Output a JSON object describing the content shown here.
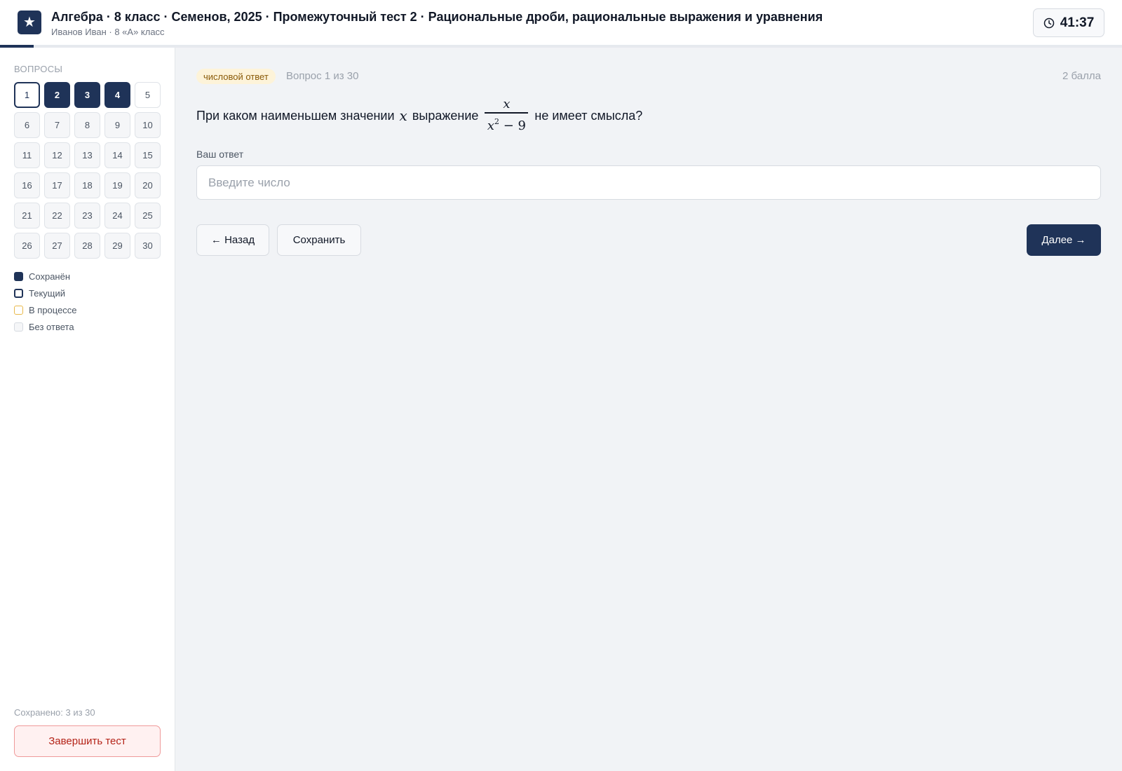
{
  "header": {
    "logo_icon": "star-icon",
    "title": "Алгебра · 8 класс · Семенов, 2025 · Промежуточный тест 2 · Рациональные дроби, рациональные выражения и уравнения",
    "subtitle": "Иванов Иван · 8 «А» класс",
    "timer": "41:37",
    "progress_fraction": 0.03
  },
  "sidebar": {
    "heading": "ВОПРОСЫ",
    "questions": [
      {
        "n": "1",
        "state": "current"
      },
      {
        "n": "2",
        "state": "saved"
      },
      {
        "n": "3",
        "state": "saved"
      },
      {
        "n": "4",
        "state": "saved"
      },
      {
        "n": "5",
        "state": "plain"
      },
      {
        "n": "6",
        "state": "empty"
      },
      {
        "n": "7",
        "state": "empty"
      },
      {
        "n": "8",
        "state": "empty"
      },
      {
        "n": "9",
        "state": "empty"
      },
      {
        "n": "10",
        "state": "empty"
      },
      {
        "n": "11",
        "state": "empty"
      },
      {
        "n": "12",
        "state": "empty"
      },
      {
        "n": "13",
        "state": "empty"
      },
      {
        "n": "14",
        "state": "empty"
      },
      {
        "n": "15",
        "state": "empty"
      },
      {
        "n": "16",
        "state": "empty"
      },
      {
        "n": "17",
        "state": "empty"
      },
      {
        "n": "18",
        "state": "empty"
      },
      {
        "n": "19",
        "state": "empty"
      },
      {
        "n": "20",
        "state": "empty"
      },
      {
        "n": "21",
        "state": "empty"
      },
      {
        "n": "22",
        "state": "empty"
      },
      {
        "n": "23",
        "state": "empty"
      },
      {
        "n": "24",
        "state": "empty"
      },
      {
        "n": "25",
        "state": "empty"
      },
      {
        "n": "26",
        "state": "empty"
      },
      {
        "n": "27",
        "state": "empty"
      },
      {
        "n": "28",
        "state": "empty"
      },
      {
        "n": "29",
        "state": "empty"
      },
      {
        "n": "30",
        "state": "empty"
      }
    ],
    "legend": {
      "saved": "Сохранён",
      "current": "Текущий",
      "in_progress": "В процессе",
      "no_answer": "Без ответа"
    },
    "saved_count": "Сохранено: 3 из 30",
    "finish_label": "Завершить тест"
  },
  "main": {
    "tag": "числовой ответ",
    "question_number": "Вопрос 1 из 30",
    "points": "2 балла",
    "question": {
      "before": "При каком наименьшем значении",
      "var": "x",
      "middle": "выражение",
      "frac_num": "x",
      "frac_den_base": "x",
      "frac_den_exp": "2",
      "frac_den_rest": " − 9",
      "after": "не имеет смысла?"
    },
    "answer_label": "Ваш ответ",
    "answer_placeholder": "Введите число",
    "answer_value": "",
    "back_label": "← Назад",
    "save_label": "Сохранить",
    "next_label": "Далее →"
  },
  "colors": {
    "accent": "#1f3358",
    "tag_bg": "#fdf3d9",
    "finish_border": "#ef9a9a",
    "in_progress": "#e8b84a"
  }
}
